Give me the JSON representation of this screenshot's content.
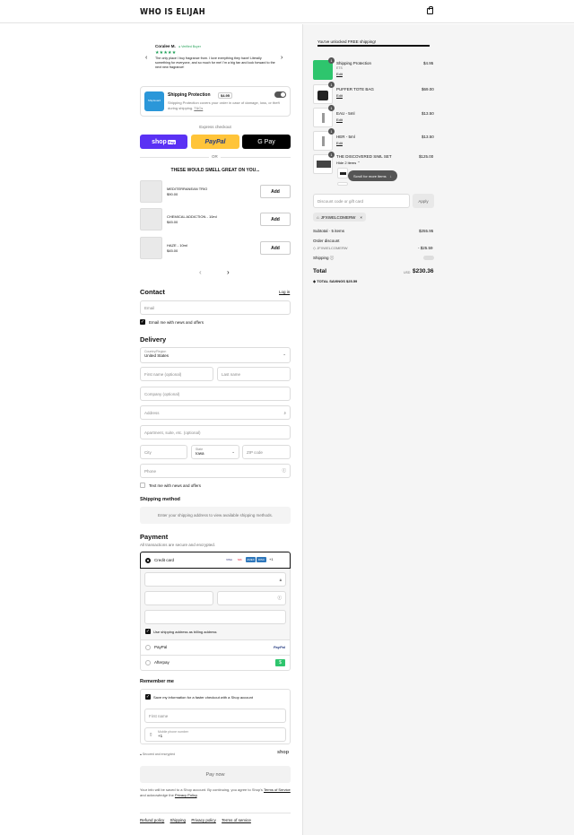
{
  "header": {
    "brand": "WHO IS ELIJAH"
  },
  "review": {
    "name": "Coralee M.",
    "verified": "Verified Buyer",
    "stars": "★★★★★",
    "text": "The only place I buy fragrance from. I love everything they have! Literally something for everyone, and so much for me! I'm a big fan and look forward to the next new fragrance!"
  },
  "protection": {
    "logo": "ShipGuard",
    "title": "Shipping Protection",
    "price": "$4.95",
    "desc": "Shipping Protection covers your order in case of damage, loss, or theft during shipping.",
    "tcs": "T&Cs"
  },
  "express": {
    "label": "Express checkout",
    "shop": "shop",
    "shop_sub": "Pay",
    "paypal": "PayPal",
    "gpay": "G Pay",
    "or": "OR"
  },
  "upsell": {
    "title": "THESE WOULD SMELL GREAT ON YOU...",
    "add_label": "Add",
    "items": [
      {
        "name": "MEDITERRANEAN TRIO",
        "price": "$90.00"
      },
      {
        "name": "CHEMICAL ADDICTION - 10ml",
        "price": "$45.00"
      },
      {
        "name": "HAZE - 10ml",
        "price": "$45.00"
      }
    ]
  },
  "contact": {
    "title": "Contact",
    "login": "Log in",
    "email_placeholder": "Email",
    "news": "Email me with news and offers"
  },
  "delivery": {
    "title": "Delivery",
    "country_label": "Country/Region",
    "country": "United States",
    "first": "First name (optional)",
    "last": "Last name",
    "company": "Company (optional)",
    "address": "Address",
    "apt": "Apartment, suite, etc. (optional)",
    "city": "City",
    "state_label": "State",
    "state": "Iowa",
    "zip": "ZIP code",
    "phone": "Phone",
    "text_me": "Text me with news and offers"
  },
  "shipping_method": {
    "title": "Shipping method",
    "msg": "Enter your shipping address to view available shipping methods."
  },
  "payment": {
    "title": "Payment",
    "sub": "All transactions are secure and encrypted.",
    "credit": "Credit card",
    "cards": [
      "VISA",
      "MC",
      "AMEX",
      "DISC"
    ],
    "more": "+1",
    "billing": "Use shipping address as billing address",
    "paypal": "PayPal",
    "afterpay": "Afterpay"
  },
  "remember": {
    "title": "Remember me",
    "save": "Save my information for a faster checkout with a Shop account",
    "first": "First name",
    "mobile_label": "Mobile phone number",
    "mobile": "+1",
    "secure": "Secured and encrypted",
    "shop": "shop"
  },
  "paynow": "Pay now",
  "legal": {
    "a": "Your info will be saved to a Shop account. By continuing, you agree to Shop's",
    "terms": "Terms of Service",
    "b": "and acknowledge the",
    "privacy": "Privacy Policy"
  },
  "footer": {
    "refund": "Refund policy",
    "shipping": "Shipping",
    "privacy": "Privacy policy",
    "terms": "Terms of service"
  },
  "cart": {
    "unlocked": "You've unlocked FREE shipping!",
    "free_progress": 1.0,
    "items": [
      {
        "qty": "1",
        "name": "Shipping Protection",
        "sub": "ETS",
        "edit": "Edit",
        "price": "$4.95"
      },
      {
        "qty": "1",
        "name": "PUFFER TOTE BAG",
        "edit": "Edit",
        "price": "$69.00"
      },
      {
        "qty": "1",
        "name": "EAU - 5ml",
        "edit": "Edit",
        "price": "$13.50"
      },
      {
        "qty": "1",
        "name": "HER - 5ml",
        "edit": "Edit",
        "price": "$13.50"
      },
      {
        "qty": "1",
        "name": "THE DISCOVERED SIML SET",
        "sub": "Hide 2 items",
        "price": "$125.00"
      }
    ],
    "scroll": "Scroll for more items",
    "discount_placeholder": "Discount code or gift card",
    "apply": "Apply",
    "code": "JFXWELCOMERW",
    "subtotal_label": "Subtotal · 5 items",
    "subtotal": "$255.95",
    "discount_label": "Order discount",
    "discount_code": "JFXWELCOMERW",
    "discount": "- $25.59",
    "ship_label": "Shipping",
    "total_label": "Total",
    "currency": "USD",
    "total": "$230.36",
    "savings_label": "TOTAL SAVINGS",
    "savings": "$25.59"
  }
}
